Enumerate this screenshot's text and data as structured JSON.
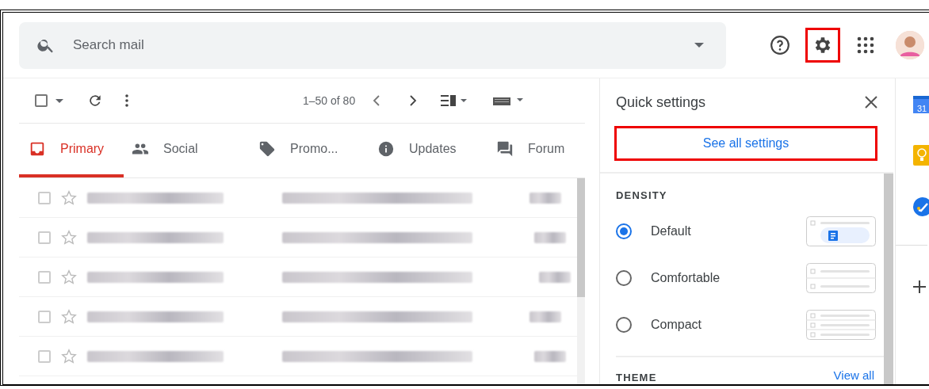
{
  "search": {
    "placeholder": "Search mail"
  },
  "toolbar": {
    "select_all": {
      "checked": false
    },
    "page_range": "1–50 of 80"
  },
  "tabs": [
    {
      "label": "Primary",
      "kind": "primary",
      "selected": true
    },
    {
      "label": "Social",
      "kind": "social",
      "selected": false
    },
    {
      "label": "Promo...",
      "kind": "promotions",
      "selected": false
    },
    {
      "label": "Updates",
      "kind": "updates",
      "selected": false
    },
    {
      "label": "Forum",
      "kind": "forums",
      "selected": false
    }
  ],
  "rows": [
    {
      "checked": false,
      "starred": false
    },
    {
      "checked": false,
      "starred": false
    },
    {
      "checked": false,
      "starred": false
    },
    {
      "checked": false,
      "starred": false
    },
    {
      "checked": false,
      "starred": false
    }
  ],
  "quick_settings": {
    "title": "Quick settings",
    "see_all": "See all settings",
    "density_heading": "DENSITY",
    "density_options": [
      {
        "label": "Default",
        "kind": "default",
        "selected": true
      },
      {
        "label": "Comfortable",
        "kind": "comfortable",
        "selected": false
      },
      {
        "label": "Compact",
        "kind": "compact",
        "selected": false
      }
    ],
    "theme_heading": "THEME",
    "view_all": "View all"
  },
  "side_panel": {
    "calendar_day": "31"
  }
}
